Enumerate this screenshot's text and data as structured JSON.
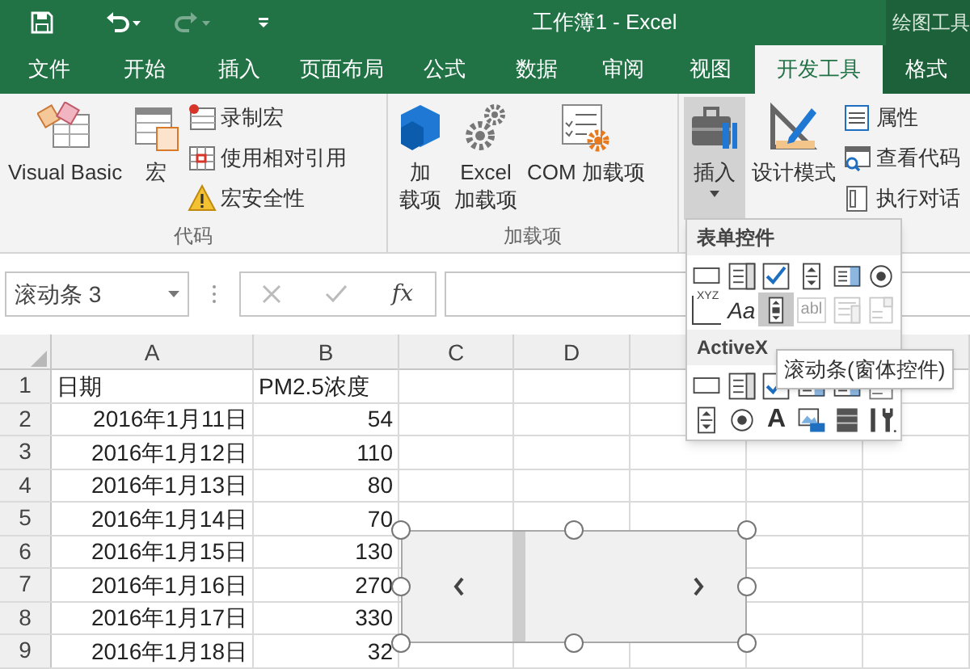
{
  "window": {
    "title": "工作簿1 - Excel",
    "context_group": "绘图工具"
  },
  "tabs": [
    {
      "label": "文件",
      "selected": false
    },
    {
      "label": "开始",
      "selected": false
    },
    {
      "label": "插入",
      "selected": false
    },
    {
      "label": "页面布局",
      "selected": false
    },
    {
      "label": "公式",
      "selected": false
    },
    {
      "label": "数据",
      "selected": false
    },
    {
      "label": "审阅",
      "selected": false
    },
    {
      "label": "视图",
      "selected": false
    },
    {
      "label": "开发工具",
      "selected": true
    },
    {
      "label": "格式",
      "selected": false,
      "contextual": true
    }
  ],
  "ribbon_groups": [
    {
      "label": "代码",
      "large_buttons": [
        {
          "kind": "vba",
          "lines": [
            "Visual Basic"
          ]
        },
        {
          "kind": "macro",
          "lines": [
            "宏"
          ]
        }
      ],
      "small_buttons": [
        {
          "kind": "record",
          "label": "录制宏"
        },
        {
          "kind": "relative",
          "label": "使用相对引用"
        },
        {
          "kind": "security",
          "label": "宏安全性"
        }
      ]
    },
    {
      "label": "加载项",
      "large_buttons": [
        {
          "kind": "addins",
          "lines": [
            "加",
            "载项"
          ]
        },
        {
          "kind": "excel_addins",
          "lines": [
            "Excel",
            "加载项"
          ]
        },
        {
          "kind": "com_addins",
          "lines": [
            "COM 加载项"
          ]
        }
      ]
    },
    {
      "large_buttons": [
        {
          "kind": "insert",
          "lines": [
            "插入"
          ],
          "highlighted": true,
          "dropdown": true
        },
        {
          "kind": "design",
          "lines": [
            "设计模式"
          ],
          "highlighted": false,
          "dropdown": false
        }
      ],
      "small_buttons": [
        {
          "kind": "properties",
          "label": "属性"
        },
        {
          "kind": "view_code",
          "label": "查看代码"
        },
        {
          "kind": "dialog",
          "label": "执行对话"
        }
      ]
    }
  ],
  "formula_bar": {
    "name_box": "滚动条 3",
    "function_button": "fx"
  },
  "sheet": {
    "columns": [
      "A",
      "B",
      "C",
      "D"
    ],
    "rows": [
      {
        "number": "1",
        "kind": "text",
        "cells": [
          "日期",
          "PM2.5浓度"
        ]
      },
      {
        "number": "2",
        "kind": "values",
        "cells": [
          "2016年1月11日",
          "54"
        ]
      },
      {
        "number": "3",
        "kind": "values",
        "cells": [
          "2016年1月12日",
          "110"
        ]
      },
      {
        "number": "4",
        "kind": "values",
        "cells": [
          "2016年1月13日",
          "80"
        ]
      },
      {
        "number": "5",
        "kind": "values",
        "cells": [
          "2016年1月14日",
          "70"
        ]
      },
      {
        "number": "6",
        "kind": "values",
        "cells": [
          "2016年1月15日",
          "130"
        ]
      },
      {
        "number": "7",
        "kind": "values",
        "cells": [
          "2016年1月16日",
          "270"
        ]
      },
      {
        "number": "8",
        "kind": "values",
        "cells": [
          "2016年1月17日",
          "330"
        ]
      },
      {
        "number": "9",
        "kind": "values",
        "cells": [
          "2016年1月18日",
          "32"
        ]
      }
    ]
  },
  "insert_menu": {
    "sections": [
      {
        "heading": "表单控件",
        "tools": [
          {
            "kind": "button",
            "disabled": false,
            "highlighted": false
          },
          {
            "kind": "combo",
            "disabled": false,
            "highlighted": false
          },
          {
            "kind": "checkbox",
            "disabled": false,
            "highlighted": false
          },
          {
            "kind": "spinner",
            "disabled": false,
            "highlighted": false
          },
          {
            "kind": "listbox",
            "disabled": false,
            "highlighted": false
          },
          {
            "kind": "option",
            "disabled": false,
            "highlighted": false
          },
          {
            "kind": "groupbox",
            "glyph": "XYZ",
            "disabled": false,
            "highlighted": false
          },
          {
            "kind": "label",
            "glyph": "Aa",
            "disabled": false,
            "highlighted": false
          },
          {
            "kind": "scrollbar",
            "disabled": false,
            "highlighted": true
          },
          {
            "kind": "textfield",
            "glyph": "abl",
            "disabled": true,
            "highlighted": false
          },
          {
            "kind": "combolist",
            "disabled": true,
            "highlighted": false
          },
          {
            "kind": "combodrop",
            "disabled": true,
            "highlighted": false
          }
        ]
      },
      {
        "heading": "ActiveX",
        "tools": [
          {
            "kind": "button",
            "disabled": false,
            "highlighted": false
          },
          {
            "kind": "combo",
            "disabled": false,
            "highlighted": false
          },
          {
            "kind": "checkbox",
            "disabled": false,
            "highlighted": false
          },
          {
            "kind": "listbox",
            "disabled": false,
            "highlighted": false
          },
          {
            "kind": "listbox",
            "disabled": false,
            "highlighted": false
          },
          {
            "kind": "combodrop",
            "disabled": false,
            "highlighted": false
          },
          {
            "kind": "spinner",
            "disabled": false,
            "highlighted": false
          },
          {
            "kind": "option",
            "disabled": false,
            "highlighted": false
          },
          {
            "kind": "biglabel",
            "glyph": "A",
            "disabled": false,
            "highlighted": false
          },
          {
            "kind": "image",
            "disabled": false,
            "highlighted": false
          },
          {
            "kind": "toggle",
            "disabled": false,
            "highlighted": false
          },
          {
            "kind": "more",
            "disabled": false,
            "highlighted": false
          }
        ]
      }
    ]
  },
  "tooltip": "滚动条(窗体控件)"
}
